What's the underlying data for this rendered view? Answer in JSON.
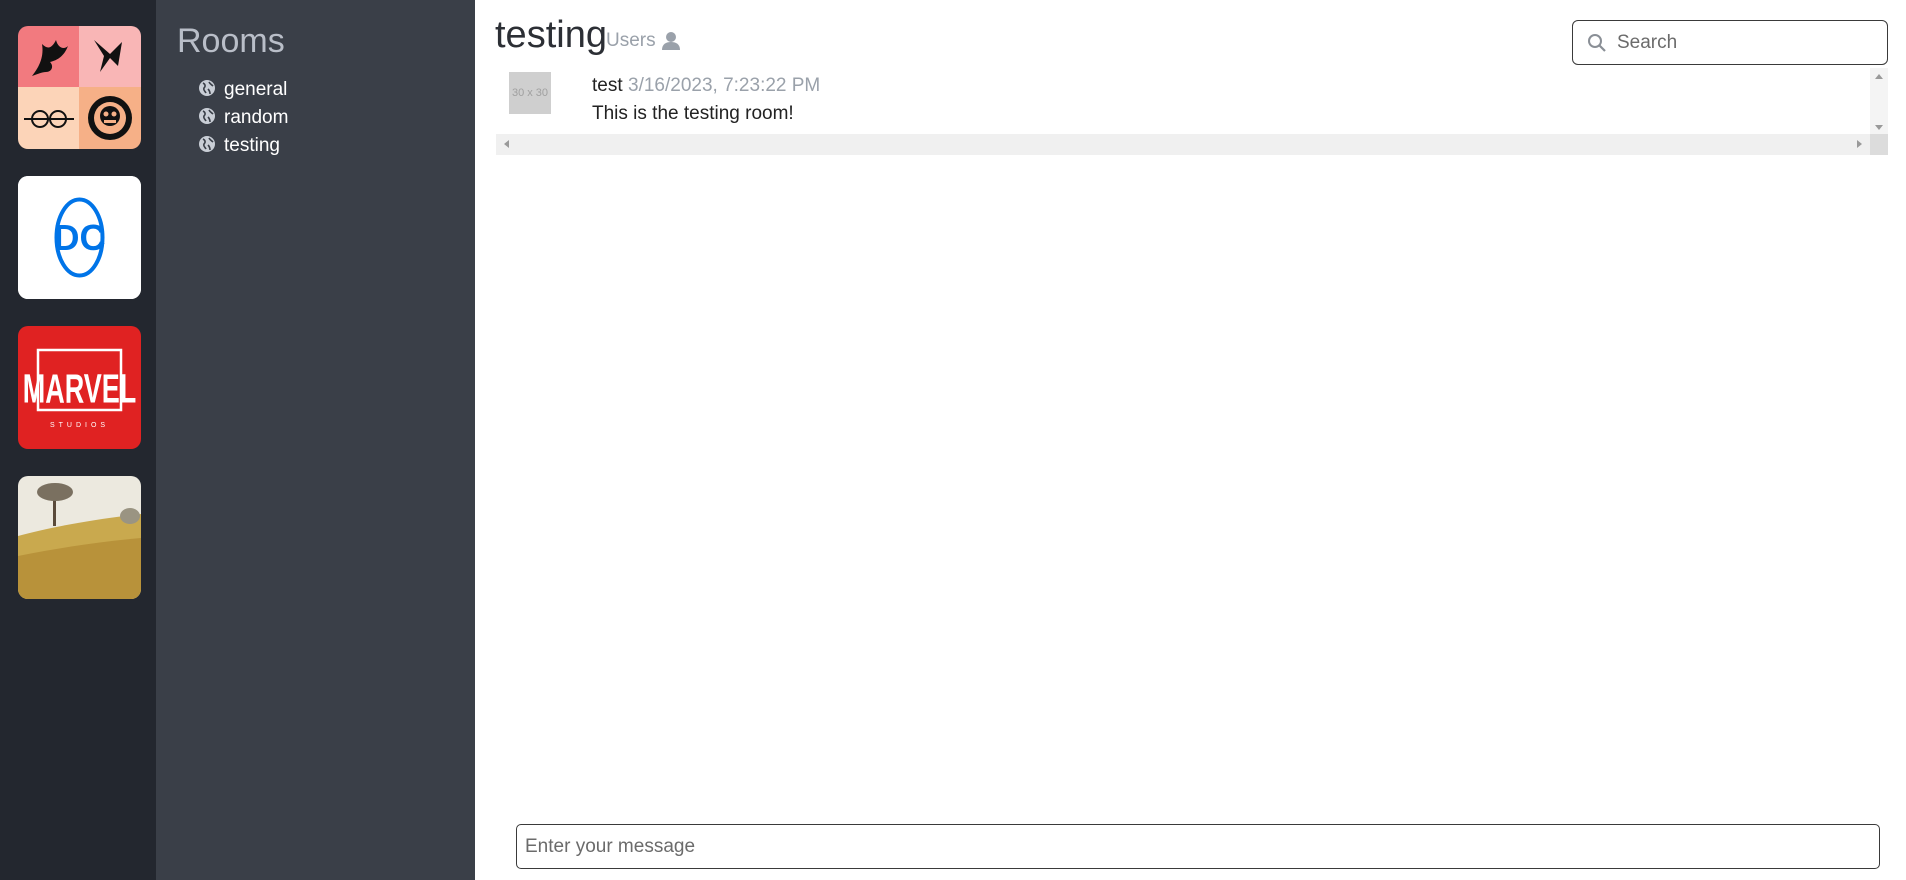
{
  "colors": {
    "rail_bg": "#23272f",
    "rooms_bg": "#3a3f48",
    "muted_text": "#9aa1aa",
    "marvel_red": "#e02222",
    "dc_blue": "#0074e8"
  },
  "servers": [
    {
      "name": "anime-server",
      "icon": "anime-collage-icon"
    },
    {
      "name": "dc-server",
      "icon": "dc-logo-icon",
      "logo_text": "DC"
    },
    {
      "name": "marvel-server",
      "icon": "marvel-studios-logo-icon",
      "logo_text": "MARVEL",
      "logo_subtext": "STUDIOS"
    },
    {
      "name": "field-server",
      "icon": "wheat-field-image-icon"
    }
  ],
  "sidebar": {
    "title": "Rooms",
    "rooms": [
      {
        "label": "general",
        "icon": "globe-icon"
      },
      {
        "label": "random",
        "icon": "globe-icon"
      },
      {
        "label": "testing",
        "icon": "globe-icon"
      }
    ]
  },
  "header": {
    "channel_title": "testing",
    "users_label": "Users",
    "users_icon": "user-icon"
  },
  "search": {
    "placeholder": "Search",
    "icon": "search-icon"
  },
  "messages": [
    {
      "avatar_placeholder": "30 x 30",
      "author": "test",
      "timestamp": "3/16/2023, 7:23:22 PM",
      "text": "This is the testing room!"
    }
  ],
  "composer": {
    "placeholder": "Enter your message"
  }
}
